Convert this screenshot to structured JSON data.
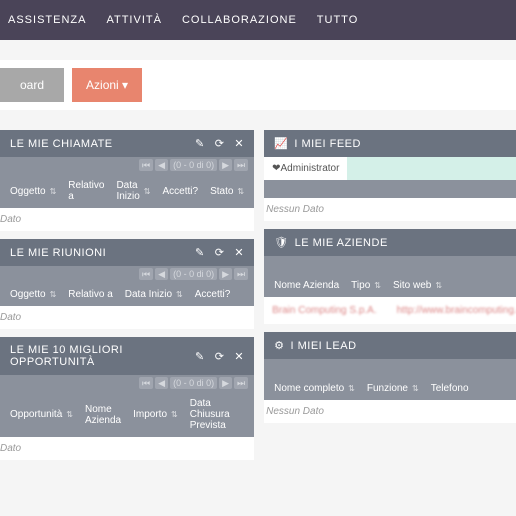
{
  "nav": {
    "items": [
      "ASSISTENZA",
      "ATTIVITÀ",
      "COLLABORAZIONE",
      "TUTTO"
    ]
  },
  "subbar": {
    "board": "oard",
    "azioni": "Azioni ▾"
  },
  "widgets": {
    "chiamate": {
      "title": "LE MIE CHIAMATE",
      "pager": "(0 - 0 di 0)",
      "cols": [
        "Oggetto",
        "Relativo a",
        "Data Inizio",
        "Accetti?",
        "Stato"
      ],
      "nodata": "Dato"
    },
    "riunioni": {
      "title": "LE MIE RIUNIONI",
      "pager": "(0 - 0 di 0)",
      "cols": [
        "Oggetto",
        "Relativo a",
        "Data Inizio",
        "Accetti?"
      ],
      "nodata": "Dato"
    },
    "opportunita": {
      "title": "LE MIE 10 MIGLIORI OPPORTUNITÀ",
      "pager": "(0 - 0 di 0)",
      "cols": [
        "Opportunità",
        "Nome Azienda",
        "Importo",
        "Data Chiusura Prevista"
      ],
      "nodata": "Dato"
    },
    "feed": {
      "title": "I MIEI FEED",
      "admin": "Administrator",
      "nodata": "Nessun Dato"
    },
    "aziende": {
      "title": "LE MIE AZIENDE",
      "cols": [
        "Nome Azienda",
        "Tipo",
        "Sito web"
      ],
      "row": {
        "name": "Brain Computing S.p.A.",
        "site": "http://www.braincomputing.com"
      }
    },
    "lead": {
      "title": "I MIEI LEAD",
      "cols": [
        "Nome completo",
        "Funzione",
        "Telefono"
      ],
      "nodata": "Nessun Dato"
    }
  },
  "sort_glyph": "⇅"
}
